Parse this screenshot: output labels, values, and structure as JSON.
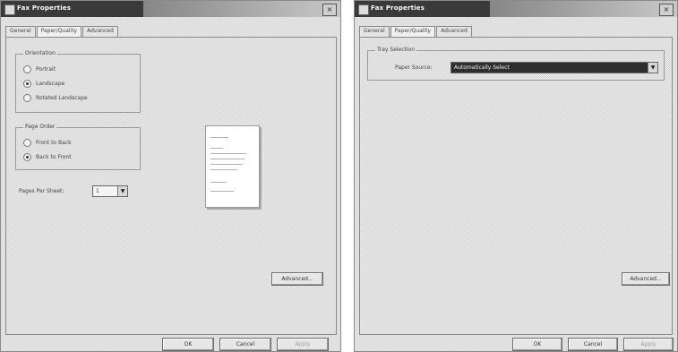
{
  "left_window": {
    "title": "Fax Properties",
    "close_symbol": "×",
    "tabs": [
      "General",
      "Paper/Quality",
      "Advanced"
    ],
    "orientation": {
      "title": "Orientation",
      "options": [
        "Portrait",
        "Landscape",
        "Rotated Landscape"
      ],
      "selected": 1
    },
    "page_order": {
      "title": "Page Order",
      "options": [
        "Front to Back",
        "Back to Front"
      ],
      "selected": 1
    },
    "pages_per_sheet": {
      "label": "Pages Per Sheet:",
      "value": "1"
    },
    "advanced_button": "Advanced...",
    "ok_button": "OK",
    "cancel_button": "Cancel",
    "apply_button": "Apply"
  },
  "right_window": {
    "title": "Fax Properties",
    "close_symbol": "×",
    "tabs": [
      "General",
      "Paper/Quality",
      "Advanced"
    ],
    "tray_selection": {
      "title": "Tray Selection",
      "paper_source_label": "Paper Source:",
      "paper_source_value": "Automatically Select"
    },
    "advanced_button": "Advanced...",
    "ok_button": "OK",
    "cancel_button": "Cancel",
    "apply_button": "Apply"
  },
  "colors": {
    "title_dark": "#3a3a3a",
    "dialog_bg": "#d4d4d4",
    "selected_field": "#2e2e2e"
  }
}
